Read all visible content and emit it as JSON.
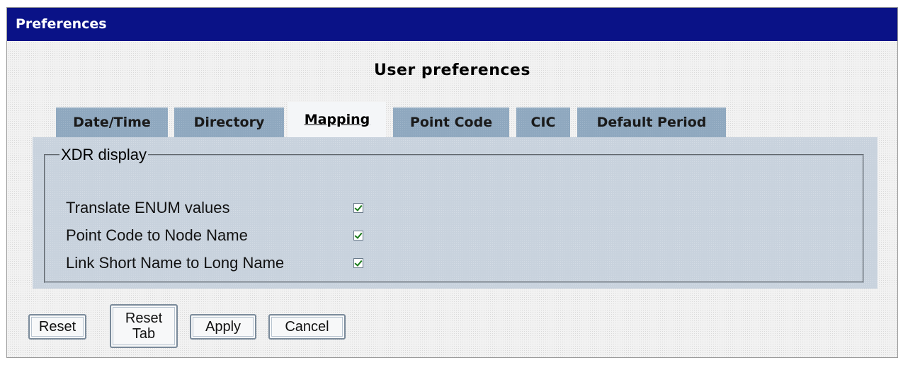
{
  "window": {
    "title": "Preferences"
  },
  "page": {
    "heading": "User preferences"
  },
  "tabs": [
    {
      "label": "Date/Time",
      "active": false
    },
    {
      "label": "Directory",
      "active": false
    },
    {
      "label": "Mapping",
      "active": true
    },
    {
      "label": "Point Code",
      "active": false
    },
    {
      "label": "CIC",
      "active": false
    },
    {
      "label": "Default Period",
      "active": false
    }
  ],
  "xdr_display": {
    "legend": "XDR display",
    "options": [
      {
        "label": "Translate ENUM values",
        "checked": true
      },
      {
        "label": "Point Code to Node Name",
        "checked": true
      },
      {
        "label": "Link Short Name to Long Name",
        "checked": true
      }
    ]
  },
  "buttons": {
    "reset": "Reset",
    "reset_tab_line1": "Reset",
    "reset_tab_line2": "Tab",
    "apply": "Apply",
    "cancel": "Cancel"
  },
  "colors": {
    "titlebar": "#0a1287",
    "tab_inactive": "#8fa8bf",
    "panel": "#c8d2dd",
    "checkmark": "#1a7a1a"
  }
}
